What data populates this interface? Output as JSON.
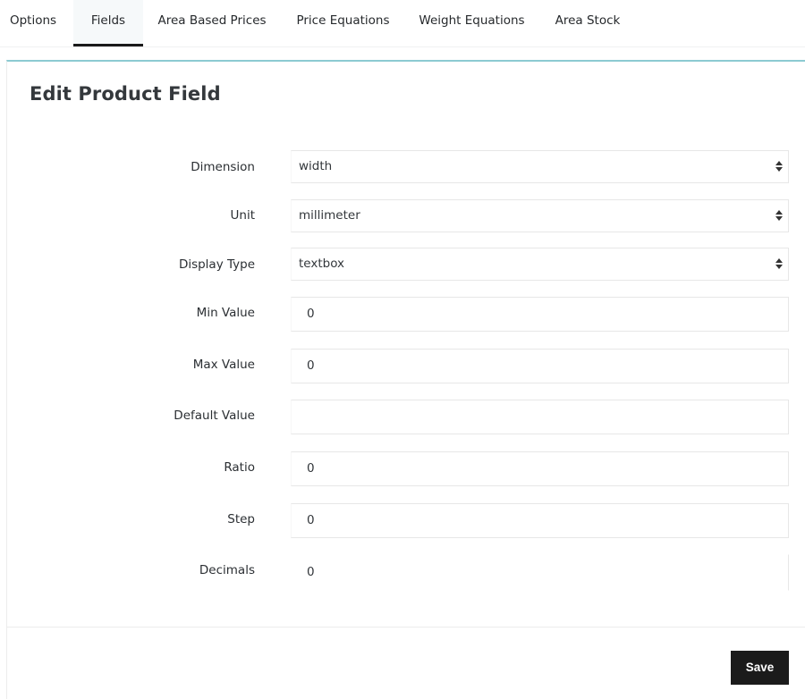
{
  "tabs": [
    {
      "label": "Options",
      "active": false
    },
    {
      "label": "Fields",
      "active": true
    },
    {
      "label": "Area Based Prices",
      "active": false
    },
    {
      "label": "Price Equations",
      "active": false
    },
    {
      "label": "Weight Equations",
      "active": false
    },
    {
      "label": "Area Stock",
      "active": false
    }
  ],
  "page": {
    "title": "Edit Product Field"
  },
  "form": {
    "fields": [
      {
        "label": "Dimension",
        "type": "select",
        "value": "width"
      },
      {
        "label": "Unit",
        "type": "select",
        "value": "millimeter"
      },
      {
        "label": "Display Type",
        "type": "select",
        "value": "textbox"
      },
      {
        "label": "Min Value",
        "type": "input",
        "value": "0"
      },
      {
        "label": "Max Value",
        "type": "input",
        "value": "0"
      },
      {
        "label": "Default Value",
        "type": "input",
        "value": ""
      },
      {
        "label": "Ratio",
        "type": "input",
        "value": "0"
      },
      {
        "label": "Step",
        "type": "input",
        "value": "0"
      },
      {
        "label": "Decimals",
        "type": "input",
        "value": "0"
      }
    ],
    "save_label": "Save"
  },
  "colors": {
    "accent_border": "#8ccad2",
    "active_tab_underline": "#1a1a1a",
    "save_button_bg": "#1b1b1b"
  },
  "icons": {
    "select_caret": "sort-caret-icon"
  }
}
